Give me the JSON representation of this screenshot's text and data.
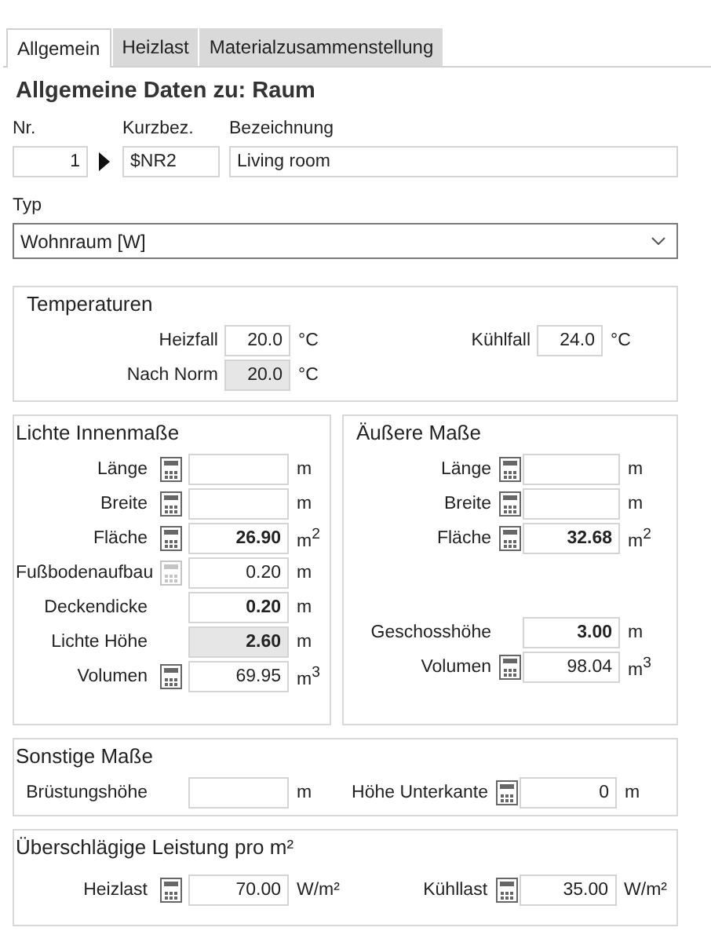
{
  "tabs": [
    {
      "label": "Allgemein",
      "selected": true
    },
    {
      "label": "Heizlast",
      "selected": false
    },
    {
      "label": "Materialzusammenstellung",
      "selected": false
    }
  ],
  "heading": "Allgemeine Daten zu: Raum",
  "ident": {
    "nr_label": "Nr.",
    "nr": "1",
    "short_label": "Kurzbez.",
    "short": "$NR2",
    "name_label": "Bezeichnung",
    "name": "Living room"
  },
  "type": {
    "label": "Typ",
    "value": "Wohnraum [W]"
  },
  "temperatures": {
    "title": "Temperaturen",
    "columns": [
      [
        [
          {
            "kind": "plain",
            "label": "Heizfall",
            "value": "20.0",
            "unit": "°C",
            "bold": false,
            "readonly": false
          },
          {
            "kind": "plain",
            "label": "Nach Norm",
            "value": "20.0",
            "unit": "°C",
            "bold": false,
            "readonly": true
          }
        ]
      ],
      [
        [
          {
            "kind": "plain",
            "label": "Kühlfall",
            "value": "24.0",
            "unit": "°C",
            "bold": false,
            "readonly": false
          }
        ]
      ]
    ]
  },
  "inner_dimensions": {
    "title": "Lichte Innenmaße",
    "columns": [
      [
        [
          {
            "kind": "calculator",
            "label": "Länge",
            "unit": "m",
            "readonly": false
          },
          {
            "kind": "calculator",
            "label": "Breite",
            "unit": "m",
            "readonly": false
          },
          {
            "kind": "calculator",
            "label": "Fläche",
            "value": "26.90",
            "unit": "m$^{2}$",
            "bold": true,
            "readonly": false
          },
          {
            "kind": "locked",
            "label": "Fußbodenaufbau",
            "value": "0.20",
            "unit": "m",
            "bold": false,
            "readonly": false
          },
          {
            "kind": "plain",
            "label": "Deckendicke",
            "value": "0.20",
            "unit": "m",
            "bold": true,
            "readonly": false
          },
          {
            "kind": "plain",
            "label": "Lichte Höhe",
            "value": "2.60",
            "unit": "m",
            "bold": true,
            "readonly": true
          },
          {
            "kind": "calculator",
            "label": "Volumen",
            "value": "69.95",
            "unit": "m$^{3}$",
            "bold": false,
            "readonly": false
          }
        ]
      ]
    ]
  },
  "outer_dimensions": {
    "title": "Äußere Maße",
    "columns": [
      [
        [
          {
            "kind": "calculator",
            "label": "Länge",
            "unit": "m",
            "readonly": false
          },
          {
            "kind": "calculator",
            "label": "Breite",
            "unit": "m",
            "readonly": false
          },
          {
            "kind": "calculator",
            "label": "Fläche",
            "value": "32.68",
            "unit": "m$^{2}$",
            "bold": true,
            "readonly": false
          }
        ],
        [
          {
            "kind": "plain",
            "label": "Geschosshöhe",
            "value": "3.00",
            "unit": "m",
            "bold": true,
            "readonly": false
          },
          {
            "kind": "calculator",
            "label": "Volumen",
            "value": "98.04",
            "unit": "m$^{3}$",
            "bold": false,
            "readonly": false
          }
        ]
      ]
    ]
  },
  "other_dimensions": {
    "title": "Sonstige Maße",
    "columns": [
      [
        [
          {
            "kind": "plain",
            "label": "Brüstungshöhe",
            "unit": "m",
            "readonly": false
          }
        ]
      ],
      [
        [
          {
            "kind": "calculator",
            "label": "Höhe Unterkante",
            "value": "0",
            "unit": "m",
            "bold": false,
            "readonly": false
          }
        ]
      ]
    ]
  },
  "approx_load": {
    "title": "Überschlägige Leistung pro m²",
    "columns": [
      [
        [
          {
            "kind": "calculator",
            "label": "Heizlast",
            "value": "70.00",
            "unit": "W/m²",
            "bold": false,
            "readonly": false
          }
        ]
      ],
      [
        [
          {
            "kind": "calculator",
            "label": "Kühllast",
            "value": "35.00",
            "unit": "W/m²",
            "bold": false,
            "readonly": false
          }
        ]
      ]
    ]
  }
}
